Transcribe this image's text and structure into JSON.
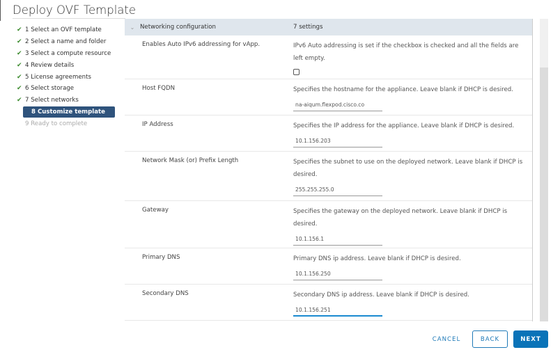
{
  "window": {
    "title": "Deploy OVF Template"
  },
  "steps": [
    {
      "label": "1 Select an OVF template",
      "state": "done"
    },
    {
      "label": "2 Select a name and folder",
      "state": "done"
    },
    {
      "label": "3 Select a compute resource",
      "state": "done"
    },
    {
      "label": "4 Review details",
      "state": "done"
    },
    {
      "label": "5 License agreements",
      "state": "done"
    },
    {
      "label": "6 Select storage",
      "state": "done"
    },
    {
      "label": "7 Select networks",
      "state": "done"
    },
    {
      "label": "8 Customize template",
      "state": "active"
    },
    {
      "label": "9 Ready to complete",
      "state": "future"
    }
  ],
  "section": {
    "title": "Networking configuration",
    "count": "7 settings"
  },
  "settings": [
    {
      "label": "Enables Auto IPv6 addressing for vApp.",
      "desc": "IPv6 Auto addressing is set if the checkbox is checked and all the fields are left empty.",
      "type": "checkbox",
      "checked": false
    },
    {
      "label": "Host FQDN",
      "desc": "Specifies the hostname for the appliance. Leave blank if DHCP is desired.",
      "type": "text",
      "value": "na-aiqum.flexpod.cisco.co"
    },
    {
      "label": "IP Address",
      "desc": "Specifies the IP address for the appliance. Leave blank if DHCP is desired.",
      "type": "text",
      "value": "10.1.156.203"
    },
    {
      "label": "Network Mask (or) Prefix Length",
      "desc": "Specifies the subnet to use on the deployed network. Leave blank if DHCP is desired.",
      "type": "text",
      "value": "255.255.255.0"
    },
    {
      "label": "Gateway",
      "desc": "Specifies the gateway on the deployed network. Leave blank if DHCP is desired.",
      "type": "text",
      "value": "10.1.156.1"
    },
    {
      "label": "Primary DNS",
      "desc": "Primary DNS ip address. Leave blank if DHCP is desired.",
      "type": "text",
      "value": "10.1.156.250"
    },
    {
      "label": "Secondary DNS",
      "desc": "Secondary DNS ip address. Leave blank if DHCP is desired.",
      "type": "text",
      "value": "10.1.156.251"
    }
  ],
  "buttons": {
    "cancel": "CANCEL",
    "back": "BACK",
    "next": "NEXT"
  },
  "colors": {
    "accent": "#0a73b8",
    "active_step": "#2f537c",
    "check": "#3c8b2e"
  }
}
